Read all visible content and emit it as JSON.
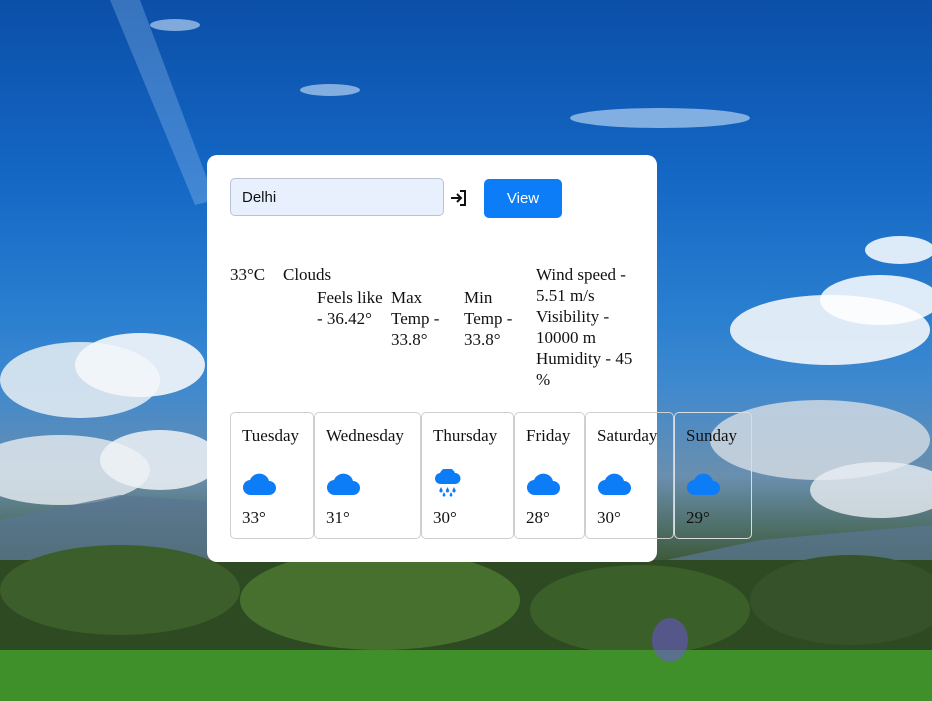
{
  "search": {
    "value": "Delhi"
  },
  "view_label": "View",
  "current": {
    "temp": "33°C",
    "condition": "Clouds",
    "feels_like": "Feels like - 36.42°",
    "max_temp": "Max Temp - 33.8°",
    "min_temp": "Min Temp - 33.8°",
    "wind_speed": "Wind speed - 5.51 m/s",
    "visibility": "Visibility - 10000 m",
    "humidity": "Humidity - 45 %"
  },
  "forecast": [
    {
      "day": "Tuesday",
      "icon": "cloud-icon",
      "temp": "33°"
    },
    {
      "day": "Wednesday",
      "icon": "cloud-icon",
      "temp": "31°"
    },
    {
      "day": "Thursday",
      "icon": "rain-cloud-icon",
      "temp": "30°"
    },
    {
      "day": "Friday",
      "icon": "cloud-icon",
      "temp": "28°"
    },
    {
      "day": "Saturday",
      "icon": "cloud-icon",
      "temp": "30°"
    },
    {
      "day": "Sunday",
      "icon": "cloud-icon",
      "temp": "29°"
    }
  ],
  "colors": {
    "accent": "#0d7cf7",
    "icon": "#0d7cf7"
  }
}
